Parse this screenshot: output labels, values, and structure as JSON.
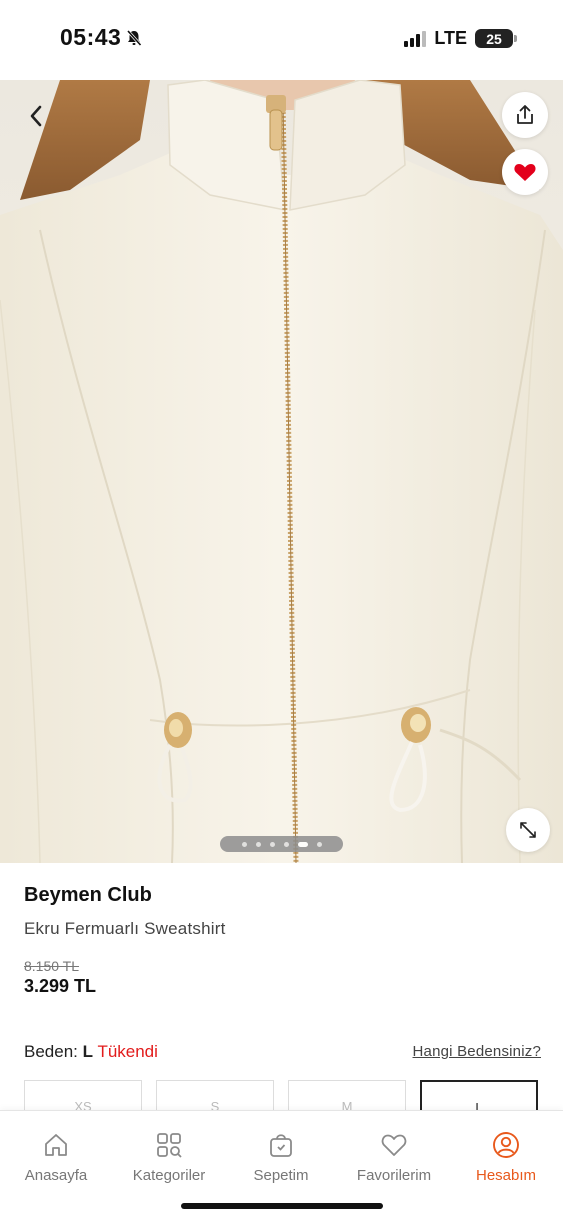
{
  "status_bar": {
    "time": "05:43",
    "network": "LTE",
    "battery": "25"
  },
  "gallery": {
    "image_count": 6,
    "active_index": 4
  },
  "product": {
    "brand": "Beymen Club",
    "name": "Ekru Fermuarlı Sweatshirt",
    "old_price": "8.150 TL",
    "price": "3.299 TL",
    "favorited": true
  },
  "size_section": {
    "label": "Beden:",
    "selected_size": "L",
    "stock_status": "Tükendi",
    "guide_link": "Hangi Bedensiniz?",
    "options": [
      "XS",
      "S",
      "M",
      "L"
    ]
  },
  "tab_bar": {
    "items": [
      {
        "label": "Anasayfa",
        "icon": "home-icon"
      },
      {
        "label": "Kategoriler",
        "icon": "categories-icon"
      },
      {
        "label": "Sepetim",
        "icon": "cart-icon"
      },
      {
        "label": "Favorilerim",
        "icon": "heart-icon"
      },
      {
        "label": "Hesabım",
        "icon": "account-icon"
      }
    ],
    "active": 4
  },
  "colors": {
    "accent": "#e8591c",
    "stock_out": "#e21b1b",
    "favorite": "#e3001b"
  }
}
